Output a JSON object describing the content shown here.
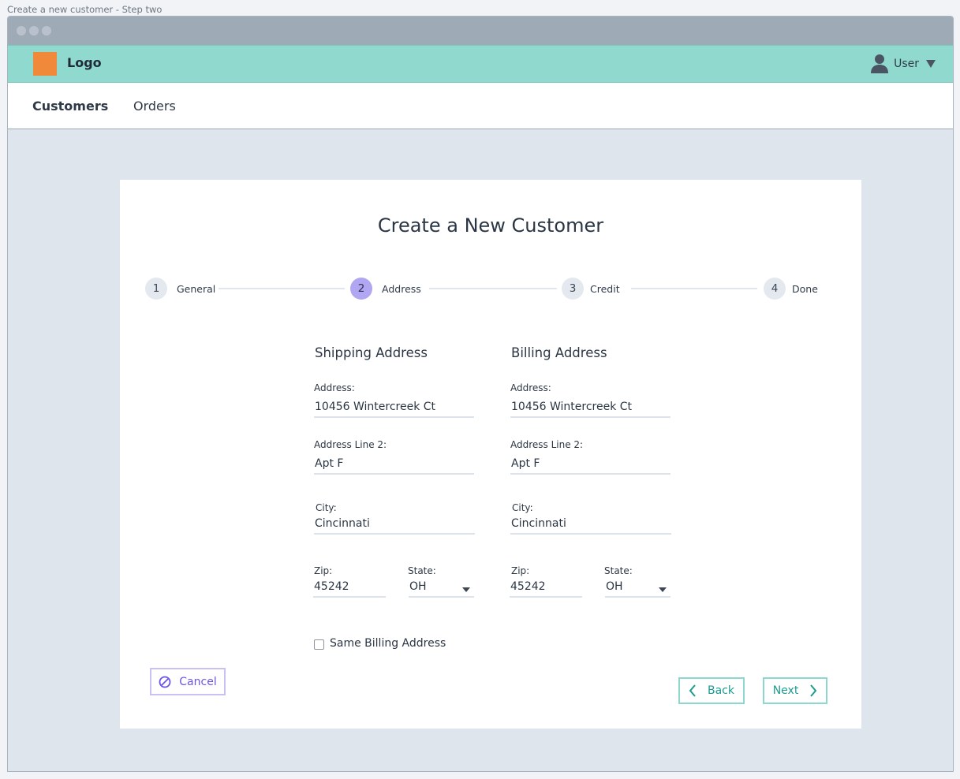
{
  "page_caption": "Create a new customer - Step two",
  "app": {
    "logo_text": "Logo",
    "user_label": "User",
    "accent": "#8fd9cf",
    "logo_color": "#f08a3a"
  },
  "nav": {
    "items": [
      {
        "label": "Customers",
        "active": true
      },
      {
        "label": "Orders",
        "active": false
      }
    ]
  },
  "card": {
    "title": "Create a New Customer",
    "steps": [
      {
        "number": "1",
        "label": "General",
        "active": false
      },
      {
        "number": "2",
        "label": "Address",
        "active": true
      },
      {
        "number": "3",
        "label": "Credit",
        "active": false
      },
      {
        "number": "4",
        "label": "Done",
        "active": false
      }
    ],
    "shipping": {
      "title": "Shipping Address",
      "address_label": "Address:",
      "address": "10456 Wintercreek Ct",
      "line2_label": "Address Line 2:",
      "line2": "Apt F",
      "city_label": "City:",
      "city": "Cincinnati",
      "zip_label": "Zip:",
      "zip": "45242",
      "state_label": "State:",
      "state": "OH"
    },
    "billing": {
      "title": "Billing Address",
      "address_label": "Address:",
      "address": "10456 Wintercreek Ct",
      "line2_label": "Address Line 2:",
      "line2": "Apt F",
      "city_label": "City:",
      "city": "Cincinnati",
      "zip_label": "Zip:",
      "zip": "45242",
      "state_label": "State:",
      "state": "OH"
    },
    "same_billing_label": "Same Billing Address",
    "same_billing_checked": false,
    "buttons": {
      "cancel": "Cancel",
      "back": "Back",
      "next": "Next"
    }
  }
}
